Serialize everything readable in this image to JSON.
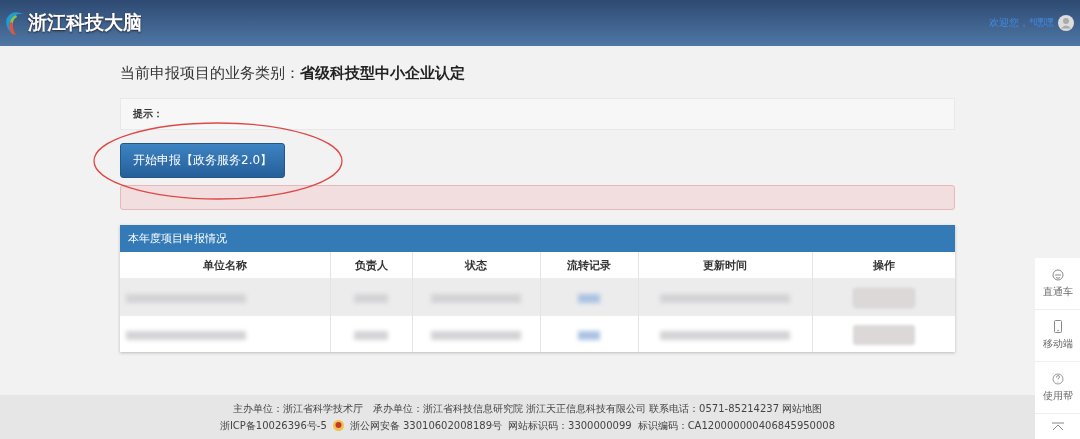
{
  "header": {
    "logo_text": "浙江科技大脑",
    "welcome": "欢迎您，*嘿嘿"
  },
  "business_type": {
    "label": "当前申报项目的业务类别：",
    "value": "省级科技型中小企业认定"
  },
  "hint": {
    "label": "提示："
  },
  "start_button": {
    "label": "开始申报【政务服务2.0】"
  },
  "table": {
    "title": "本年度项目申报情况",
    "columns": [
      "单位名称",
      "负责人",
      "状态",
      "流转记录",
      "更新时间",
      "操作"
    ],
    "rows": [
      {
        "selected": true
      },
      {
        "selected": false
      }
    ]
  },
  "side_panel": [
    {
      "kind": "car",
      "label": "直通车"
    },
    {
      "kind": "phone",
      "label": "移动端"
    },
    {
      "kind": "help",
      "label": "使用帮"
    },
    {
      "kind": "top"
    }
  ],
  "footer": {
    "line_1": "主办单位：浙江省科学技术厅　承办单位：浙江省科技信息研究院 浙江天正信息科技有限公司 联系电话：0571-85214237 网站地图",
    "icp": "浙ICP备10026396号-5",
    "police": "浙公网安备 33010602008189号",
    "site_code": "网站标识码：3300000099",
    "code": "标识编码：CA120000000406845950008"
  }
}
